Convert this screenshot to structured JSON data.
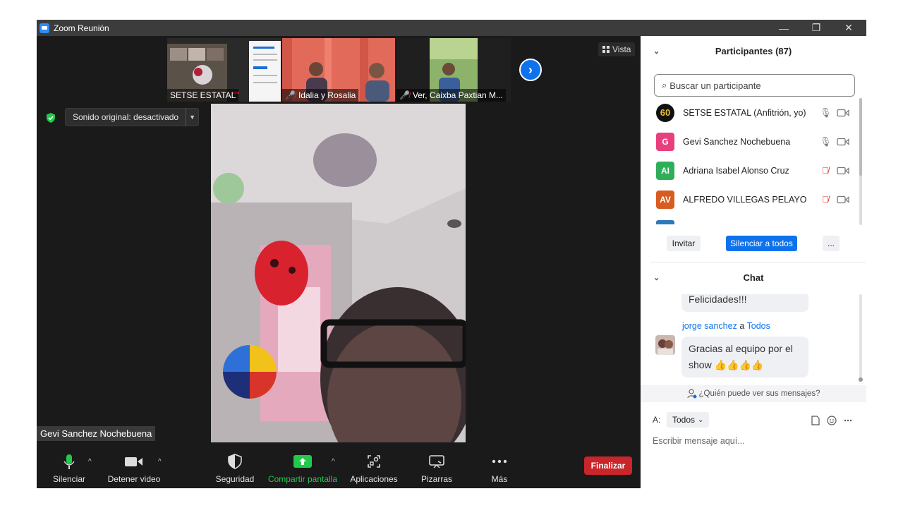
{
  "window": {
    "title": "Zoom Reunión",
    "minimize": "—",
    "restore": "❐",
    "close": "✕"
  },
  "strip": {
    "thumbs": [
      {
        "name": "SETSE ESTATAL"
      },
      {
        "name": "Idalia y Rosalia"
      },
      {
        "name": "Ver, Caixba Paxtian M..."
      }
    ],
    "view_label": "Vista"
  },
  "stage": {
    "sound_label": "Sonido original: desactivado",
    "speaker_name": "Gevi Sanchez Nochebuena"
  },
  "toolbar": {
    "mute": "Silenciar",
    "stop_video": "Detener video",
    "security": "Seguridad",
    "share": "Compartir pantalla",
    "apps": "Aplicaciones",
    "whiteboards": "Pizarras",
    "more": "Más",
    "end": "Finalizar",
    "share_color": "#23c94a",
    "end_color": "#c8262a"
  },
  "participants": {
    "header": "Participantes (87)",
    "search_placeholder": "Buscar un participante",
    "list": [
      {
        "initials": "60",
        "name": "SETSE ESTATAL (Anfitrión, yo)",
        "color": "#111111",
        "muted": false
      },
      {
        "initials": "G",
        "name": "Gevi Sanchez Nochebuena",
        "color": "#e8407e",
        "muted": false
      },
      {
        "initials": "AI",
        "name": "Adriana Isabel Alonso Cruz",
        "color": "#2fae59",
        "muted": true
      },
      {
        "initials": "AV",
        "name": "ALFREDO VILLEGAS PELAYO",
        "color": "#d75c1f",
        "muted": true
      }
    ],
    "invite": "Invitar",
    "mute_all": "Silenciar a todos",
    "more": "..."
  },
  "chat": {
    "header": "Chat",
    "prev_message": "Felicidades!!!",
    "sender": "jorge sanchez",
    "to_word": "a",
    "recipient": "Todos",
    "message_line1": "Gracias al equipo por el",
    "message_line2": "show",
    "thumbs": "👍👍👍👍",
    "who_sees": "¿Quién puede ver sus mensajes?",
    "to_label": "A:",
    "to_value": "Todos",
    "compose_placeholder": "Escribir mensaje aquí...",
    "accent": "#0e72ed"
  }
}
